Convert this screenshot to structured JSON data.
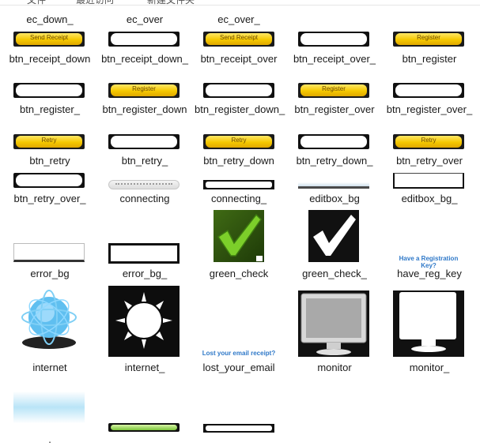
{
  "top_strip": [
    "文件",
    "最近访问",
    "新建文件夹"
  ],
  "rows": [
    {
      "labels": [
        "ec_down_",
        "ec_over",
        "ec_over_",
        "",
        ""
      ]
    },
    {
      "labels": [
        "btn_receipt_down",
        "btn_receipt_down_",
        "btn_receipt_over",
        "btn_receipt_over_",
        "btn_register"
      ]
    },
    {
      "labels": [
        "btn_register_",
        "btn_register_down",
        "btn_register_down_",
        "btn_register_over",
        "btn_register_over_"
      ]
    },
    {
      "labels": [
        "btn_retry",
        "btn_retry_",
        "btn_retry_down",
        "btn_retry_down_",
        "btn_retry_over"
      ]
    },
    {
      "labels": [
        "btn_retry_over_",
        "connecting",
        "connecting_",
        "editbox_bg",
        "editbox_bg_"
      ]
    },
    {
      "labels": [
        "error_bg",
        "error_bg_",
        "green_check",
        "green_check_",
        "have_reg_key"
      ]
    },
    {
      "labels": [
        "internet",
        "internet_",
        "lost_your_email",
        "monitor",
        "monitor_"
      ]
    },
    {
      "labels": [
        ".",
        "",
        "",
        "",
        ""
      ]
    }
  ],
  "thumb_text": {
    "send_receipt": "Send Receipt",
    "register": "Register",
    "retry": "Retry",
    "have_reg_key": "Have a Registration Key?",
    "lost_email": "Lost your email receipt?"
  },
  "colors": {
    "gold_top": "#ffe866",
    "gold_bottom": "#e0a900",
    "green_check": "#5aa81a",
    "link_blue": "#2e78c8"
  }
}
